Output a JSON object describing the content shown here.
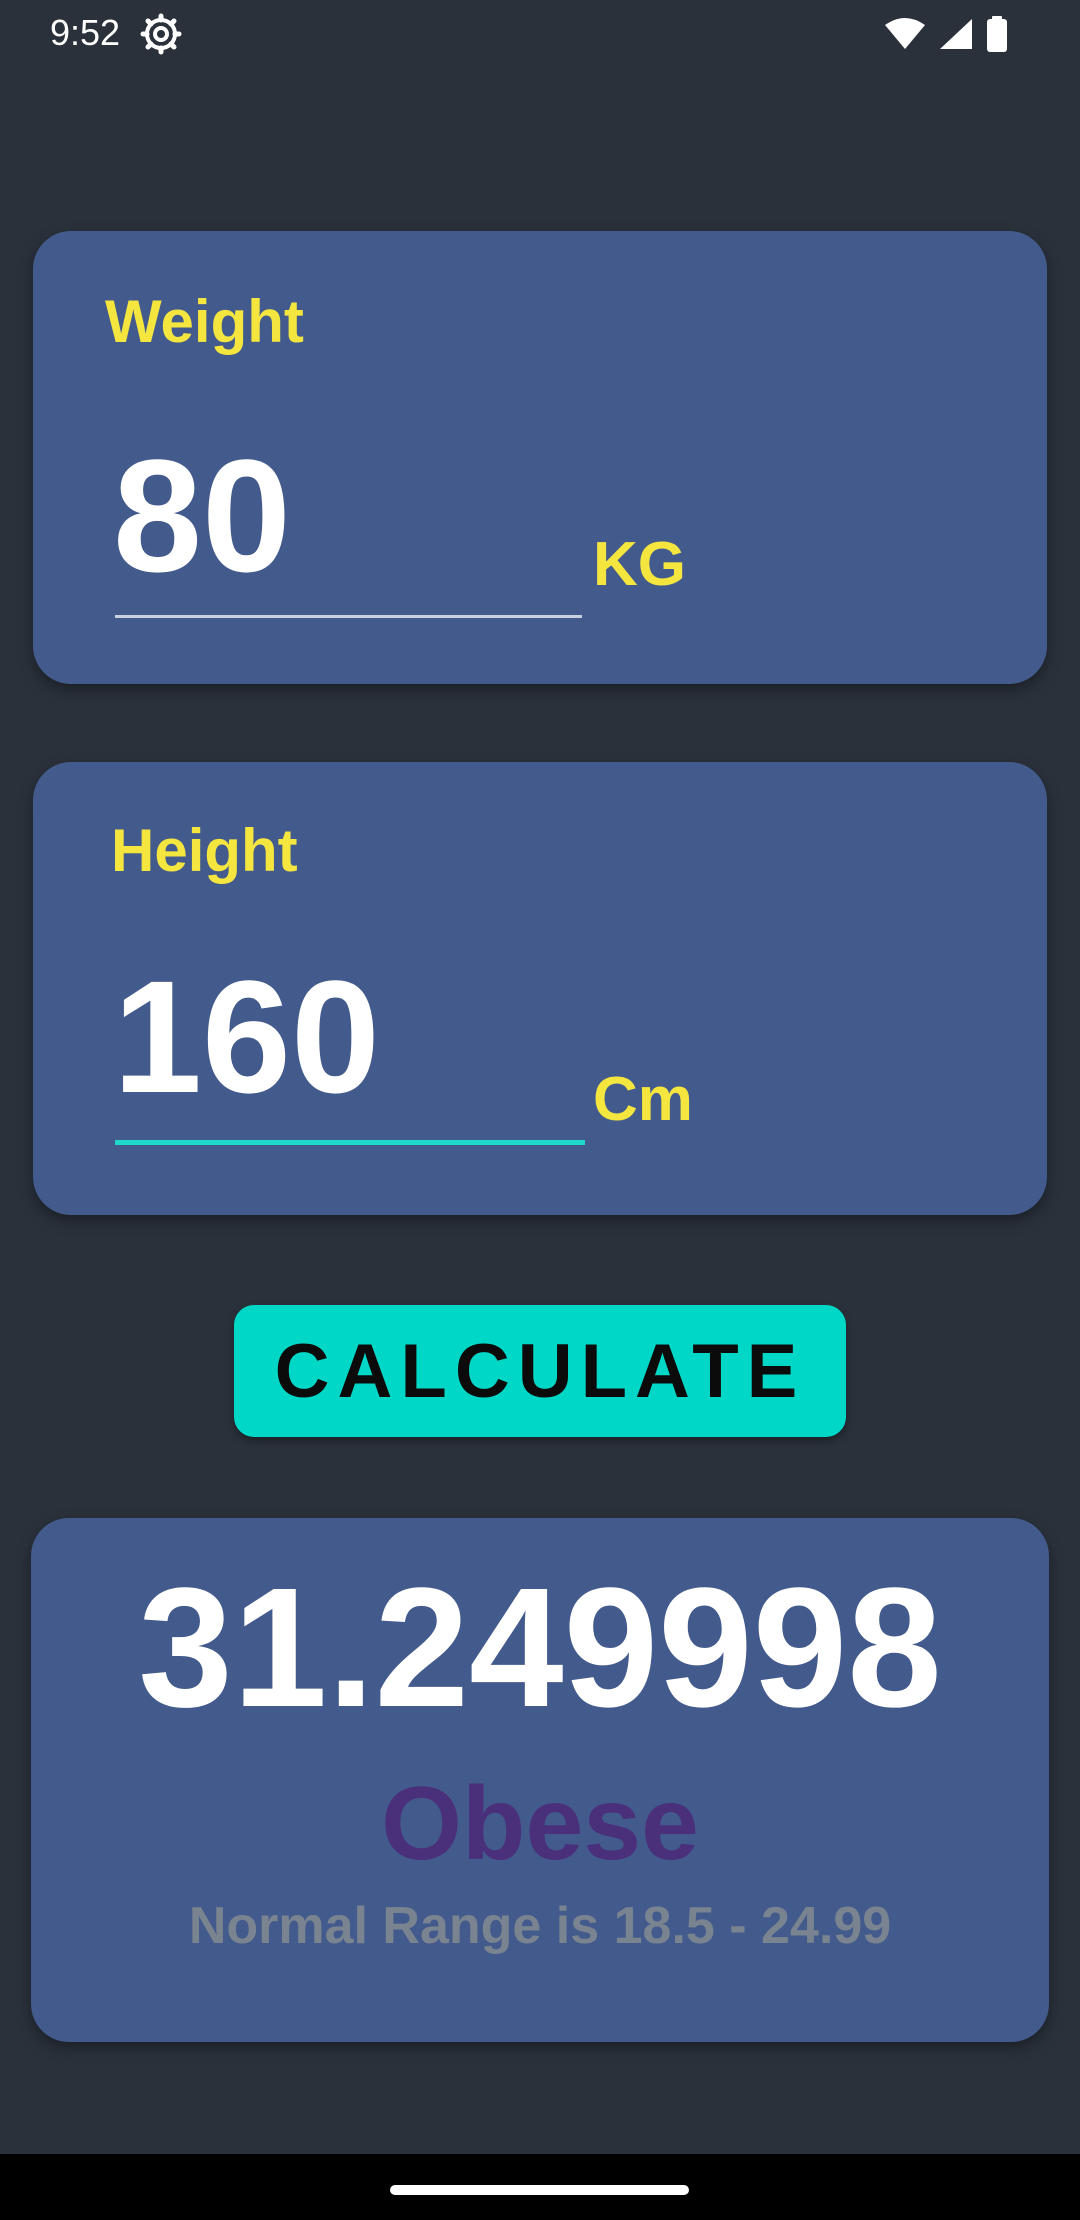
{
  "status_bar": {
    "time": "9:52",
    "icons": [
      "gear-icon",
      "wifi-icon",
      "signal-icon",
      "battery-icon"
    ]
  },
  "weight": {
    "label": "Weight",
    "value": "80",
    "unit": "KG"
  },
  "height": {
    "label": "Height",
    "value": "160",
    "unit": "Cm"
  },
  "calculate": {
    "label": "CALCULATE"
  },
  "result": {
    "bmi": "31.249998",
    "category": "Obese",
    "normal_range": "Normal Range is 18.5 - 24.99"
  },
  "colors": {
    "background": "#2a313b",
    "card": "#435b8c",
    "label_yellow": "#f5e63f",
    "accent": "#00d7c6",
    "category": "#4a2f7a",
    "muted": "#7a8390"
  }
}
